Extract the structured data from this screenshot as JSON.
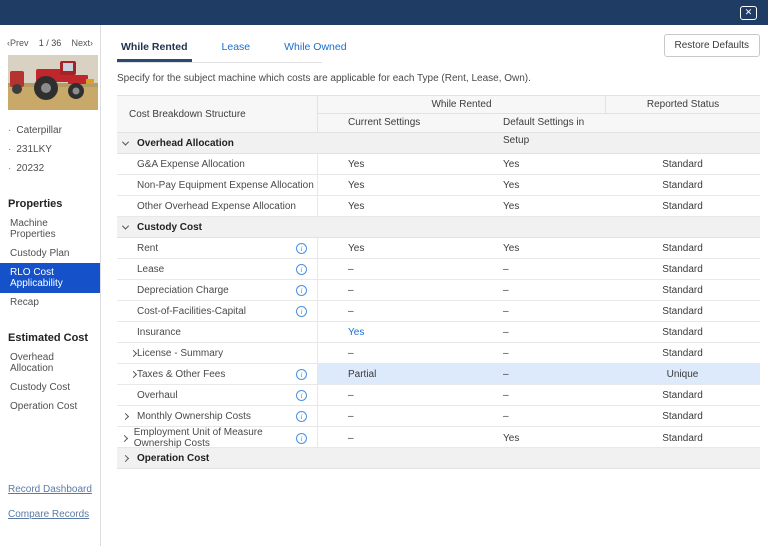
{
  "titlebar": {
    "close_label": "✕"
  },
  "pager": {
    "prev": "‹Prev",
    "page": "1 / 36",
    "next": "Next›"
  },
  "machine": {
    "photo_alt": "red-tractor-photo",
    "bullets": [
      "Caterpillar",
      "231LKY",
      "20232"
    ]
  },
  "sidebar": {
    "sections": [
      {
        "heading": "Properties",
        "items": [
          {
            "label": "Machine Properties",
            "selected": false
          },
          {
            "label": "Custody Plan",
            "selected": false
          },
          {
            "label": "RLO Cost Applicability",
            "selected": true
          },
          {
            "label": "Recap",
            "selected": false
          }
        ]
      },
      {
        "heading": "Estimated Cost",
        "items": [
          {
            "label": "Overhead Allocation",
            "selected": false
          },
          {
            "label": "Custody Cost",
            "selected": false
          },
          {
            "label": "Operation Cost",
            "selected": false
          }
        ]
      }
    ],
    "links": [
      "Record Dashboard",
      "Compare Records"
    ]
  },
  "tabs": [
    {
      "label": "While Rented",
      "active": true
    },
    {
      "label": "Lease",
      "active": false
    },
    {
      "label": "While Owned",
      "active": false
    }
  ],
  "restore_button": "Restore Defaults",
  "description": "Specify for the subject machine which costs are applicable for each Type (Rent, Lease, Own).",
  "table": {
    "col1_header": "Cost Breakdown Structure",
    "group_header": "While Rented",
    "sub_headers": [
      "Current Settings",
      "Default Settings in Setup"
    ],
    "status_header": "Reported Status",
    "rows": [
      {
        "type": "group",
        "label": "Overhead Allocation",
        "chevron": "down",
        "chevron_pos": "outer",
        "info": false
      },
      {
        "type": "item",
        "label": "G&A Expense Allocation",
        "chevron": null,
        "info": false,
        "current": "Yes",
        "current_blue": false,
        "default": "Yes",
        "status": "Standard",
        "highlight": false
      },
      {
        "type": "item",
        "label": "Non-Pay Equipment Expense Allocation",
        "chevron": null,
        "info": false,
        "current": "Yes",
        "current_blue": false,
        "default": "Yes",
        "status": "Standard",
        "highlight": false
      },
      {
        "type": "item",
        "label": "Other Overhead Expense Allocation",
        "chevron": null,
        "info": false,
        "current": "Yes",
        "current_blue": false,
        "default": "Yes",
        "status": "Standard",
        "highlight": false
      },
      {
        "type": "group",
        "label": "Custody Cost",
        "chevron": "down",
        "chevron_pos": "outer",
        "info": false
      },
      {
        "type": "item",
        "label": "Rent",
        "chevron": null,
        "info": true,
        "current": "Yes",
        "current_blue": false,
        "default": "Yes",
        "status": "Standard",
        "highlight": false
      },
      {
        "type": "item",
        "label": "Lease",
        "chevron": null,
        "info": true,
        "current": "–",
        "current_blue": false,
        "default": "–",
        "status": "Standard",
        "highlight": false
      },
      {
        "type": "item",
        "label": "Depreciation Charge",
        "chevron": null,
        "info": true,
        "current": "–",
        "current_blue": false,
        "default": "–",
        "status": "Standard",
        "highlight": false
      },
      {
        "type": "item",
        "label": "Cost-of-Facilities-Capital",
        "chevron": null,
        "info": true,
        "current": "–",
        "current_blue": false,
        "default": "–",
        "status": "Standard",
        "highlight": false
      },
      {
        "type": "item",
        "label": "Insurance",
        "chevron": null,
        "info": false,
        "current": "Yes",
        "current_blue": true,
        "default": "–",
        "status": "Standard",
        "highlight": false
      },
      {
        "type": "item",
        "label": "License - Summary",
        "chevron": "right",
        "chevron_pos": "inner",
        "info": false,
        "current": "–",
        "current_blue": false,
        "default": "–",
        "status": "Standard",
        "highlight": false
      },
      {
        "type": "item",
        "label": "Taxes & Other Fees",
        "chevron": "right",
        "chevron_pos": "inner",
        "info": true,
        "current": "Partial",
        "current_blue": false,
        "default": "–",
        "status": "Unique",
        "highlight": true
      },
      {
        "type": "item",
        "label": "Overhaul",
        "chevron": null,
        "info": true,
        "current": "–",
        "current_blue": false,
        "default": "–",
        "status": "Standard",
        "highlight": false
      },
      {
        "type": "item",
        "label": "Monthly Ownership Costs",
        "chevron": "right",
        "chevron_pos": "outer",
        "info": true,
        "current": "–",
        "current_blue": false,
        "default": "–",
        "status": "Standard",
        "highlight": false
      },
      {
        "type": "item",
        "label": "Employment Unit of Measure Ownership Costs",
        "chevron": "right",
        "chevron_pos": "outer",
        "info": true,
        "current": "–",
        "current_blue": false,
        "default": "Yes",
        "status": "Standard",
        "highlight": false
      },
      {
        "type": "group",
        "label": "Operation Cost",
        "chevron": "right",
        "chevron_pos": "outer",
        "info": false
      }
    ]
  },
  "colors": {
    "titlebar_navy": "#1f3c64",
    "selected_item_blue": "#1551c9",
    "link_blue": "#1a6ed1",
    "highlight_row_blue": "#ddeafc",
    "info_icon_blue": "#4a90e2",
    "sidebar_link": "#5b7aa6"
  }
}
